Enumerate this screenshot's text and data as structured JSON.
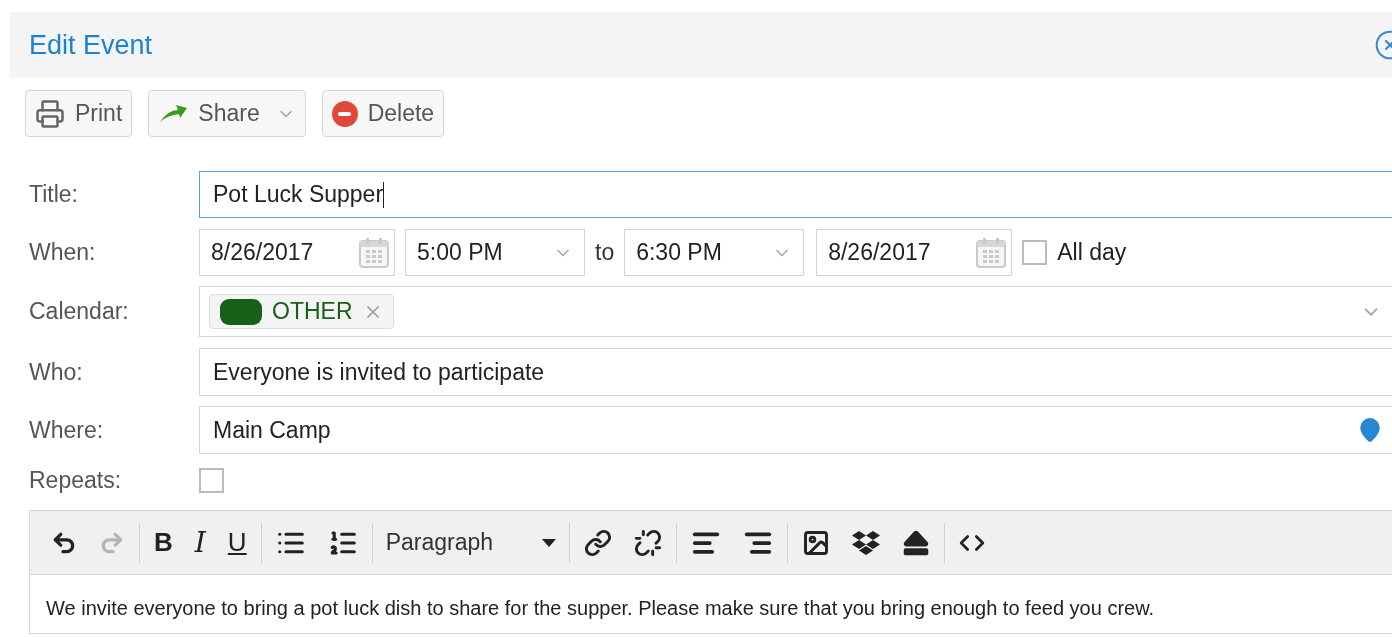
{
  "dialog": {
    "title": "Edit Event"
  },
  "actions": [
    {
      "kind": "print",
      "label": "Print"
    },
    {
      "kind": "share",
      "label": "Share"
    },
    {
      "kind": "delete",
      "label": "Delete"
    }
  ],
  "form": {
    "title": {
      "label": "Title:",
      "value": "Pot Luck Supper",
      "focused": true
    },
    "when": {
      "label": "When:",
      "start_date": "8/26/2017",
      "start_time": "5:00 PM",
      "to": "to",
      "end_time": "6:30 PM",
      "end_date": "8/26/2017",
      "all_day": {
        "label": "All day",
        "checked": false
      }
    },
    "calendar": {
      "label": "Calendar:",
      "tags": [
        {
          "name": "OTHER",
          "color": "#17601a"
        }
      ]
    },
    "who": {
      "label": "Who:",
      "value": "Everyone is invited to participate"
    },
    "where": {
      "label": "Where:",
      "value": "Main Camp"
    },
    "repeats": {
      "label": "Repeats:",
      "checked": false
    }
  },
  "editor": {
    "toolbar_groups": [
      [
        {
          "kind": "undo",
          "disabled": false
        },
        {
          "kind": "redo",
          "disabled": true
        }
      ],
      [
        {
          "kind": "bold",
          "label": "B",
          "disabled": false
        },
        {
          "kind": "italic",
          "label": "I",
          "disabled": false
        },
        {
          "kind": "underline",
          "label": "U",
          "disabled": false
        }
      ],
      [
        {
          "kind": "bullets",
          "disabled": false
        },
        {
          "kind": "numbers",
          "disabled": false
        }
      ],
      [
        {
          "kind": "format",
          "label": "Paragraph",
          "disabled": false
        }
      ],
      [
        {
          "kind": "link",
          "disabled": false
        },
        {
          "kind": "unlink",
          "disabled": false
        }
      ],
      [
        {
          "kind": "alignleft",
          "disabled": false
        },
        {
          "kind": "alignright",
          "disabled": false
        }
      ],
      [
        {
          "kind": "image",
          "disabled": false
        },
        {
          "kind": "dropbox",
          "disabled": false
        },
        {
          "kind": "upload",
          "disabled": false
        }
      ],
      [
        {
          "kind": "code",
          "disabled": false
        }
      ]
    ],
    "body": "We invite everyone to bring a pot luck dish to share for the supper. Please make sure that you bring enough to feed you crew."
  }
}
